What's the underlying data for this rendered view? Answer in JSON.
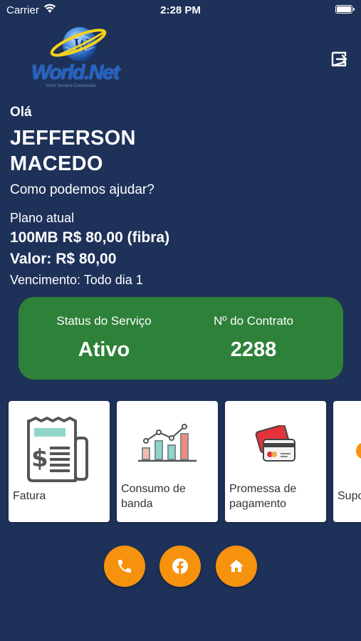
{
  "status_bar": {
    "carrier": "Carrier",
    "time": "2:28 PM"
  },
  "logo": {
    "brand": "World.Net",
    "tagline": "Você Sempre Conectado"
  },
  "greeting": {
    "hello": "Olá",
    "name": "JEFFERSON MACEDO",
    "subtitle": "Como podemos ajudar?"
  },
  "plan": {
    "label": "Plano atual",
    "name": "100MB R$ 80,00 (fibra)",
    "value": "Valor: R$ 80,00",
    "due": "Vencimento: Todo dia 1"
  },
  "status_card": {
    "service_label": "Status do Serviço",
    "service_value": "Ativo",
    "contract_label": "Nº do Contrato",
    "contract_value": "2288",
    "color": "#2e8138"
  },
  "services": [
    {
      "label": "Fatura",
      "icon": "invoice-icon"
    },
    {
      "label": "Consumo de banda",
      "icon": "bandwidth-chart-icon"
    },
    {
      "label": "Promessa de pagamento",
      "icon": "credit-card-icon"
    },
    {
      "label": "Suporte",
      "icon": "support-icon"
    }
  ],
  "actions": [
    {
      "icon": "phone-icon"
    },
    {
      "icon": "facebook-icon"
    },
    {
      "icon": "home-icon"
    }
  ],
  "colors": {
    "background": "#1e3159",
    "accent": "#f6920e",
    "card": "#ffffff"
  }
}
